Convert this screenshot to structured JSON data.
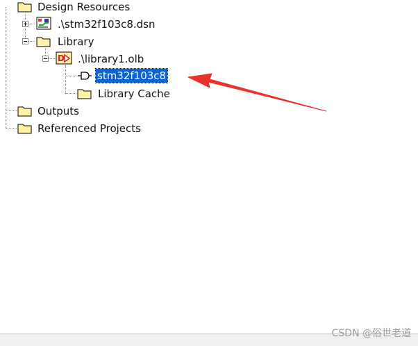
{
  "tree": {
    "root": {
      "label": "Design Resources",
      "icon": "folder-icon"
    },
    "design_file": {
      "label": ".\\stm32f103c8.dsn",
      "icon": "schematic-icon"
    },
    "library": {
      "label": "Library",
      "icon": "folder-icon"
    },
    "library_file": {
      "label": ".\\library1.olb",
      "icon": "library-file-icon"
    },
    "part": {
      "label": "stm32f103c8",
      "icon": "part-icon",
      "selected": true
    },
    "library_cache": {
      "label": "Library Cache",
      "icon": "folder-icon"
    },
    "outputs": {
      "label": "Outputs",
      "icon": "folder-icon"
    },
    "referenced_projects": {
      "label": "Referenced Projects",
      "icon": "folder-icon"
    }
  },
  "annotation": {
    "icon": "red-arrow-icon",
    "color": "#e8322b"
  },
  "watermark": "CSDN @俗世老道",
  "colors": {
    "selection": "#0a64d6",
    "folder": "#fff2a8"
  }
}
